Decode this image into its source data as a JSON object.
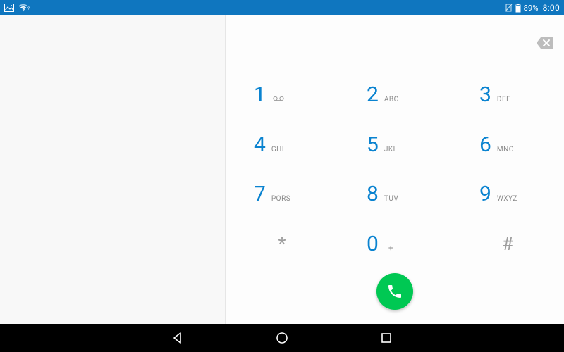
{
  "status": {
    "battery_percent": "89%",
    "clock": "8:00"
  },
  "dialpad": {
    "keys": [
      {
        "digit": "1",
        "sub": "voicemail"
      },
      {
        "digit": "2",
        "sub": "ABC"
      },
      {
        "digit": "3",
        "sub": "DEF"
      },
      {
        "digit": "4",
        "sub": "GHI"
      },
      {
        "digit": "5",
        "sub": "JKL"
      },
      {
        "digit": "6",
        "sub": "MNO"
      },
      {
        "digit": "7",
        "sub": "PQRS"
      },
      {
        "digit": "8",
        "sub": "TUV"
      },
      {
        "digit": "9",
        "sub": "WXYZ"
      },
      {
        "digit": "*",
        "sub": ""
      },
      {
        "digit": "0",
        "sub": "+"
      },
      {
        "digit": "#",
        "sub": ""
      }
    ]
  },
  "colors": {
    "status_bar": "#0f76bf",
    "digit": "#0a83d0",
    "call_button": "#00c853"
  }
}
